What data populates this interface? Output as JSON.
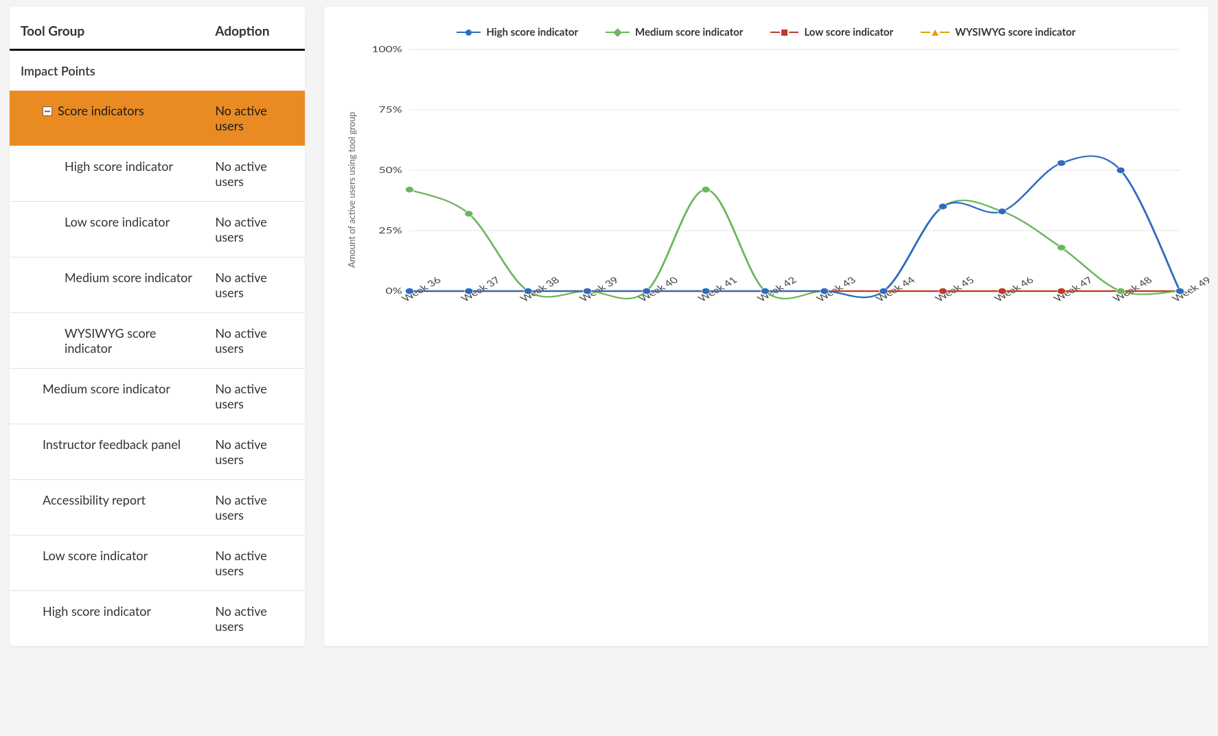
{
  "table": {
    "headers": {
      "col1": "Tool Group",
      "col2": "Adoption"
    },
    "section": "Impact Points",
    "selected": {
      "label": "Score indicators",
      "adoption": "No active users"
    },
    "children": [
      {
        "label": "High score indicator",
        "adoption": "No active users"
      },
      {
        "label": "Low score indicator",
        "adoption": "No active users"
      },
      {
        "label": "Medium score indicator",
        "adoption": "No active users"
      },
      {
        "label": "WYSIWYG score indicator",
        "adoption": "No active users"
      }
    ],
    "siblings": [
      {
        "label": "Medium score indicator",
        "adoption": "No active users"
      },
      {
        "label": "Instructor feedback panel",
        "adoption": "No active users"
      },
      {
        "label": "Accessibility report",
        "adoption": "No active users"
      },
      {
        "label": "Low score indicator",
        "adoption": "No active users"
      },
      {
        "label": "High score indicator",
        "adoption": "No active users"
      }
    ]
  },
  "chart_data": {
    "type": "line",
    "ylabel": "Amount of active users using tool group",
    "ylim": [
      0,
      100
    ],
    "yticks": [
      0,
      25,
      50,
      75,
      100
    ],
    "ytick_labels": [
      "0%",
      "25%",
      "50%",
      "75%",
      "100%"
    ],
    "categories": [
      "Week 36",
      "Week 37",
      "Week 38",
      "Week 39",
      "Week 40",
      "Week 41",
      "Week 42",
      "Week 43",
      "Week 44",
      "Week 45",
      "Week 46",
      "Week 47",
      "Week 48",
      "Week 49"
    ],
    "legend": [
      {
        "name": "High score indicator",
        "color": "#2e6bbf",
        "marker": "circle"
      },
      {
        "name": "Medium score indicator",
        "color": "#6cb65e",
        "marker": "diamond"
      },
      {
        "name": "Low score indicator",
        "color": "#c0392b",
        "marker": "square"
      },
      {
        "name": "WYSIWYG score indicator",
        "color": "#e2a000",
        "marker": "triangle"
      }
    ],
    "series": [
      {
        "name": "High score indicator",
        "color": "#2e6bbf",
        "values": [
          0,
          0,
          0,
          0,
          0,
          0,
          0,
          0,
          0,
          35,
          33,
          53,
          50,
          0
        ]
      },
      {
        "name": "Medium score indicator",
        "color": "#6cb65e",
        "values": [
          42,
          32,
          0,
          0,
          0,
          42,
          0,
          0,
          0,
          35,
          33,
          18,
          0,
          0
        ]
      },
      {
        "name": "Low score indicator",
        "color": "#c0392b",
        "values": [
          0,
          0,
          0,
          0,
          0,
          0,
          0,
          0,
          0,
          0,
          0,
          0,
          0,
          0
        ]
      },
      {
        "name": "WYSIWYG score indicator",
        "color": "#e2a000",
        "values": [
          0,
          0,
          0,
          0,
          0,
          0,
          0,
          0,
          0,
          0,
          0,
          0,
          0,
          0
        ]
      }
    ]
  }
}
